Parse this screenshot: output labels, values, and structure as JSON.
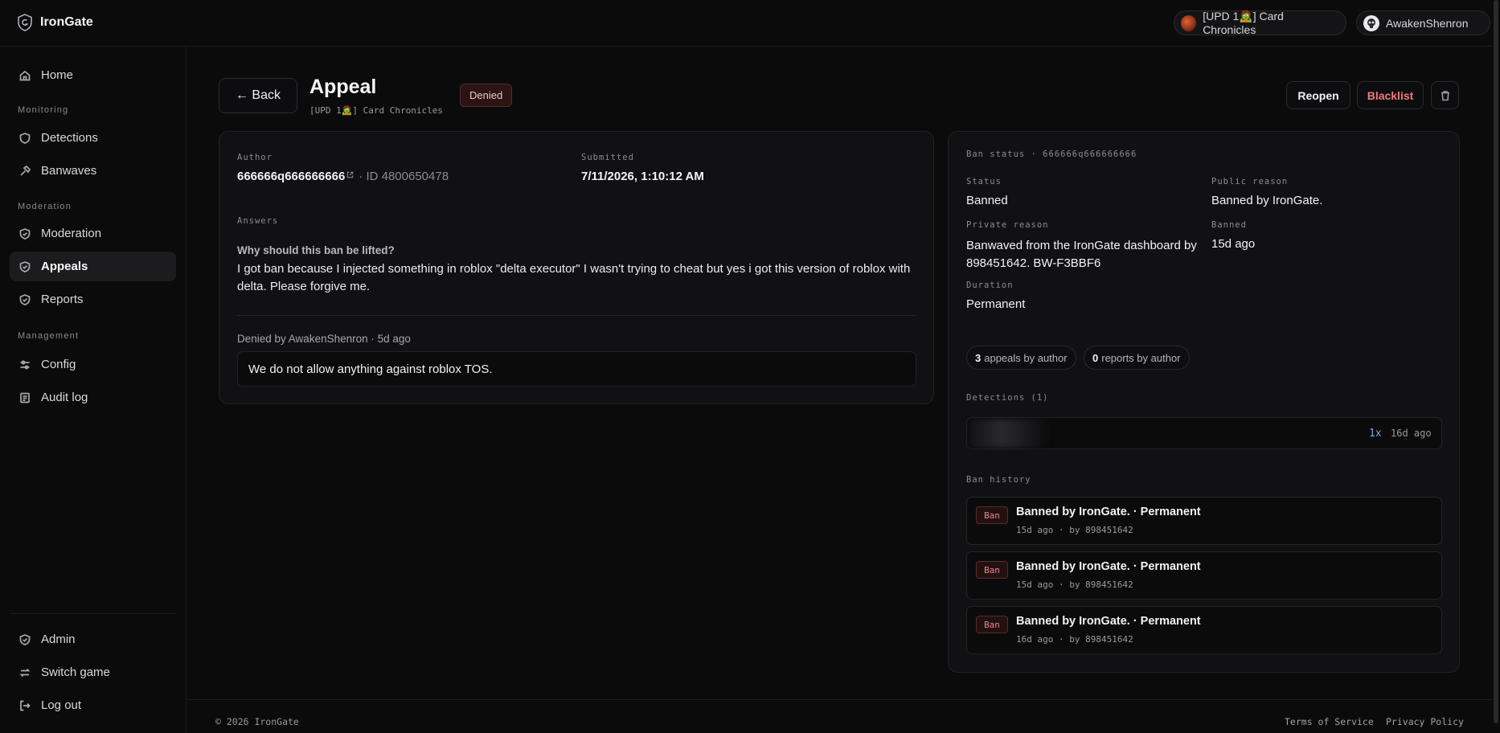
{
  "brand": {
    "name": "IronGate"
  },
  "topbar": {
    "game_pill": "[UPD 1🧟] Card Chronicles",
    "user_pill": "AwakenShenron"
  },
  "sidebar": {
    "home": "Home",
    "sections": {
      "monitoring": "Monitoring",
      "moderation": "Moderation",
      "management": "Management"
    },
    "items": {
      "detections": "Detections",
      "banwaves": "Banwaves",
      "moderation": "Moderation",
      "appeals": "Appeals",
      "reports": "Reports",
      "config": "Config",
      "audit_log": "Audit log",
      "admin": "Admin",
      "switch_game": "Switch game",
      "log_out": "Log out"
    },
    "active": "Appeals"
  },
  "header": {
    "back_label": "← Back",
    "title": "Appeal",
    "subtitle": "[UPD 1🧟] Card Chronicles",
    "status": "Denied",
    "reopen_label": "Reopen",
    "blacklist_label": "Blacklist"
  },
  "appeal": {
    "author_label": "Author",
    "author_name": "666666q666666666",
    "author_id": "· ID 4800650478",
    "submitted_label": "Submitted",
    "submitted": "7/11/2026, 1:10:12 AM",
    "answers_label": "Answers",
    "question": "Why should this ban be lifted?",
    "answer": "I got ban because I injected something in roblox \"delta executor\" I wasn't trying to cheat but yes i got this version of roblox with delta. Please forgive me.",
    "decision": "Denied by AwakenShenron · 5d ago",
    "decision_note": "We do not allow anything against roblox TOS."
  },
  "ban_status": {
    "header": "Ban status · 666666q666666666",
    "status_label": "Status",
    "status": "Banned",
    "public_reason_label": "Public reason",
    "public_reason": "Banned by IronGate.",
    "private_reason_label": "Private reason",
    "private_reason": "Banwaved from the IronGate dashboard by 898451642. BW-F3BBF6",
    "banned_label": "Banned",
    "banned": "15d ago",
    "duration_label": "Duration",
    "duration": "Permanent",
    "appeals_count": "3",
    "appeals_text": "appeals by author",
    "reports_count": "0",
    "reports_text": "reports by author"
  },
  "detections": {
    "header": "Detections (1)",
    "items": [
      {
        "count": "1x",
        "time": "16d ago"
      }
    ]
  },
  "ban_history": {
    "header": "Ban history",
    "items": [
      {
        "badge": "Ban",
        "title": "Banned by IronGate. · Permanent",
        "meta": "15d ago · by 898451642"
      },
      {
        "badge": "Ban",
        "title": "Banned by IronGate. · Permanent",
        "meta": "15d ago · by 898451642"
      },
      {
        "badge": "Ban",
        "title": "Banned by IronGate. · Permanent",
        "meta": "16d ago · by 898451642"
      }
    ]
  },
  "footer": {
    "copyright": "© 2026 IronGate",
    "terms": "Terms of Service",
    "privacy": "Privacy Policy"
  },
  "colors": {
    "background": "#0b0b0c",
    "card": "#111113",
    "danger": "#f07a7a",
    "accent_blue": "#7fa3d4"
  }
}
